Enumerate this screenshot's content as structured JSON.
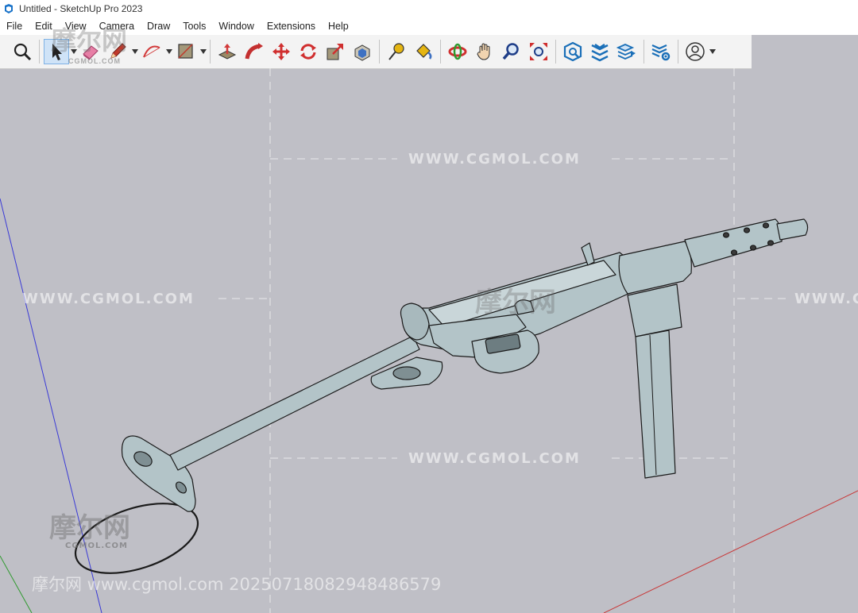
{
  "window": {
    "title": "Untitled - SketchUp Pro 2023"
  },
  "menu": [
    "File",
    "Edit",
    "View",
    "Camera",
    "Draw",
    "Tools",
    "Window",
    "Extensions",
    "Help"
  ],
  "toolbar": {
    "tools": [
      "search-icon",
      "select-tool-icon",
      "eraser-icon",
      "pencil-icon",
      "arc-icon",
      "rectangle-icon",
      "push-pull-icon",
      "follow-me-icon",
      "move-icon",
      "rotate-icon",
      "scale-icon",
      "offset-icon",
      "tape-measure-icon",
      "paint-bucket-icon",
      "orbit-icon",
      "pan-icon",
      "zoom-icon",
      "zoom-extents-icon",
      "warehouse-icon",
      "extension-warehouse-icon",
      "layout-icon",
      "extension-manager-icon",
      "account-icon"
    ]
  },
  "watermarks": {
    "site": "WWW.CGMOL.COM",
    "cn": "摩尔网",
    "small": "CGMOL.COM",
    "footer": "摩尔网 www.cgmol.com 20250718082948486579"
  },
  "colors": {
    "viewport_bg": "#bfbfc6",
    "model_fill": "#b3c4c8",
    "model_stroke": "#1a1a1a",
    "axis_blue": "#3a3ad6",
    "axis_red": "#c83838",
    "axis_green": "#2f9a2f"
  }
}
